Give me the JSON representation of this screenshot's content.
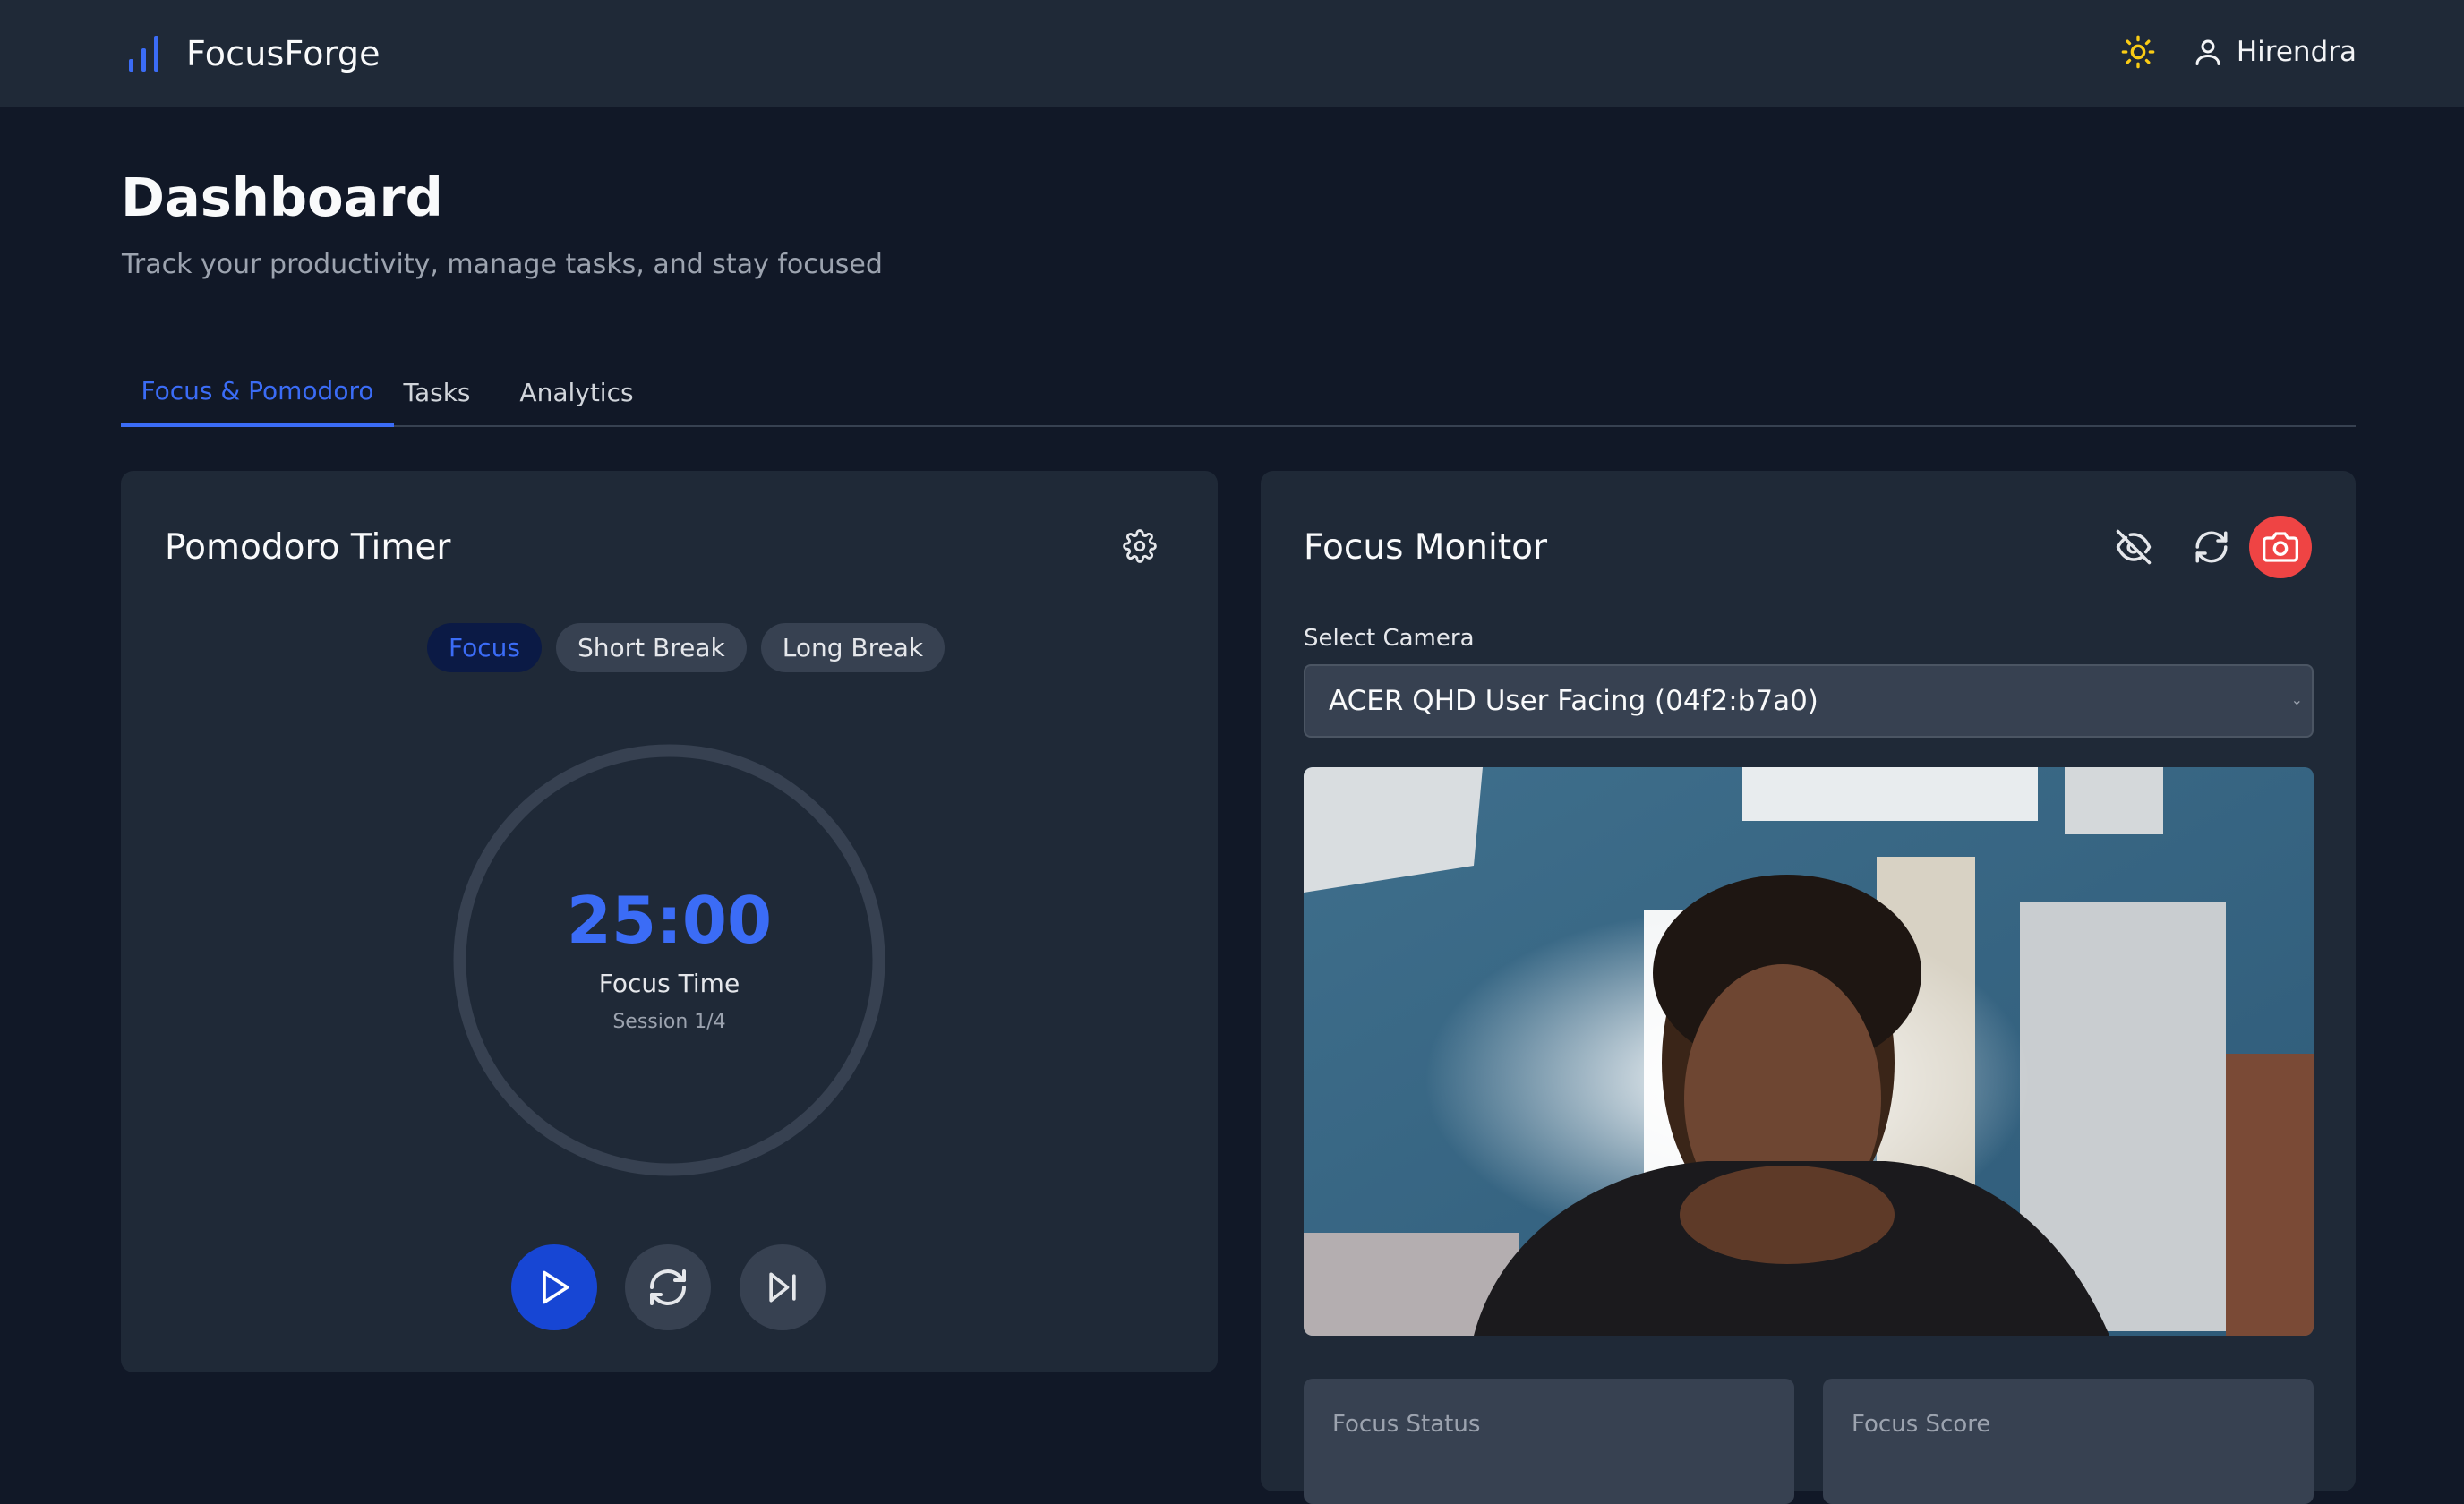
{
  "app": {
    "brand_name": "FocusForge",
    "user_name": "Hirendra",
    "accent_color": "#3b6cf6",
    "theme_icon": "sun-icon",
    "user_icon": "user-icon"
  },
  "header": {
    "title": "Dashboard",
    "subtitle": "Track your productivity, manage tasks, and stay focused"
  },
  "tabs": [
    {
      "label": "Focus & Pomodoro",
      "active": true
    },
    {
      "label": "Tasks",
      "active": false
    },
    {
      "label": "Analytics",
      "active": false
    }
  ],
  "pomodoro": {
    "title": "Pomodoro Timer",
    "settings_icon": "gear-icon",
    "modes": [
      {
        "label": "Focus",
        "active": true
      },
      {
        "label": "Short Break",
        "active": false
      },
      {
        "label": "Long Break",
        "active": false
      }
    ],
    "time": "25:00",
    "label": "Focus Time",
    "session": "Session 1/4",
    "controls": {
      "play_icon": "play-icon",
      "reset_icon": "refresh-icon",
      "skip_icon": "skip-forward-icon"
    }
  },
  "focus_monitor": {
    "title": "Focus Monitor",
    "camera_label": "Select Camera",
    "camera_selected": "ACER QHD User Facing (04f2:b7a0)",
    "buttons": {
      "hide_icon": "eye-off-icon",
      "refresh_icon": "refresh-icon",
      "camera_icon": "camera-icon",
      "camera_color": "#ef4444"
    },
    "stats": [
      {
        "label": "Focus Status"
      },
      {
        "label": "Focus Score"
      }
    ]
  }
}
